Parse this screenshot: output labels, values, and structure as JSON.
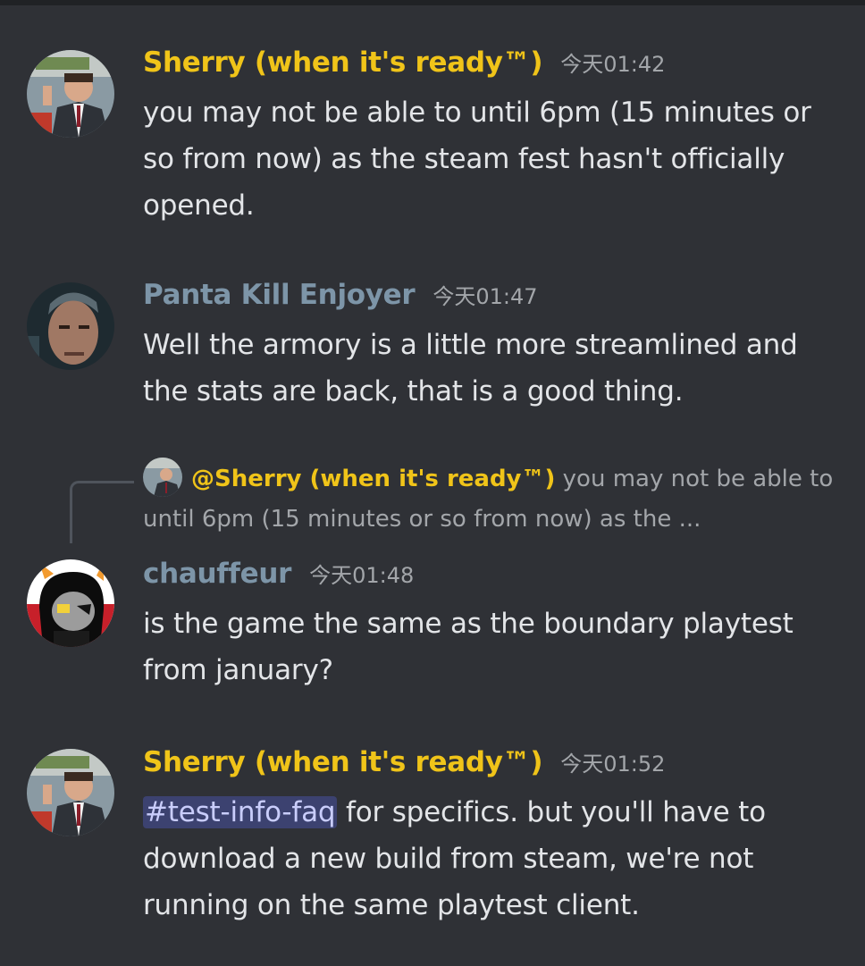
{
  "messages": [
    {
      "username": "Sherry (when it's ready™)",
      "timestamp": "今天01:42",
      "content": "you may not be able to until 6pm (15 minutes or so from now) as the steam fest hasn't officially opened."
    },
    {
      "username": "Panta Kill Enjoyer",
      "timestamp": "今天01:47",
      "content": "Well the armory is a little more streamlined and the stats are back, that is a good thing."
    },
    {
      "username": "chauffeur",
      "timestamp": "今天01:48",
      "content": "is the game the same as the boundary playtest from january?",
      "reply": {
        "mention": "@Sherry (when it's ready™)",
        "preview": "you may not be able to until 6pm (15 minutes or so from now) as the ..."
      }
    },
    {
      "username": "Sherry (when it's ready™)",
      "timestamp": "今天01:52",
      "channel_mention": "#test-info-faq",
      "content": "for specifics. but you'll have to download a new build from steam, we're not running on the same playtest client."
    }
  ],
  "colors": {
    "background": "#2f3136",
    "sherry_name": "#f0c419",
    "panta_name": "#7d95a8",
    "chauffeur_name": "#7d95a8",
    "channel_mention_bg": "#3c4270"
  },
  "icons": {
    "sherry_avatar": "man-in-suit-avatar",
    "panta_avatar": "man-face-avatar",
    "chauffeur_avatar": "horned-character-avatar"
  }
}
